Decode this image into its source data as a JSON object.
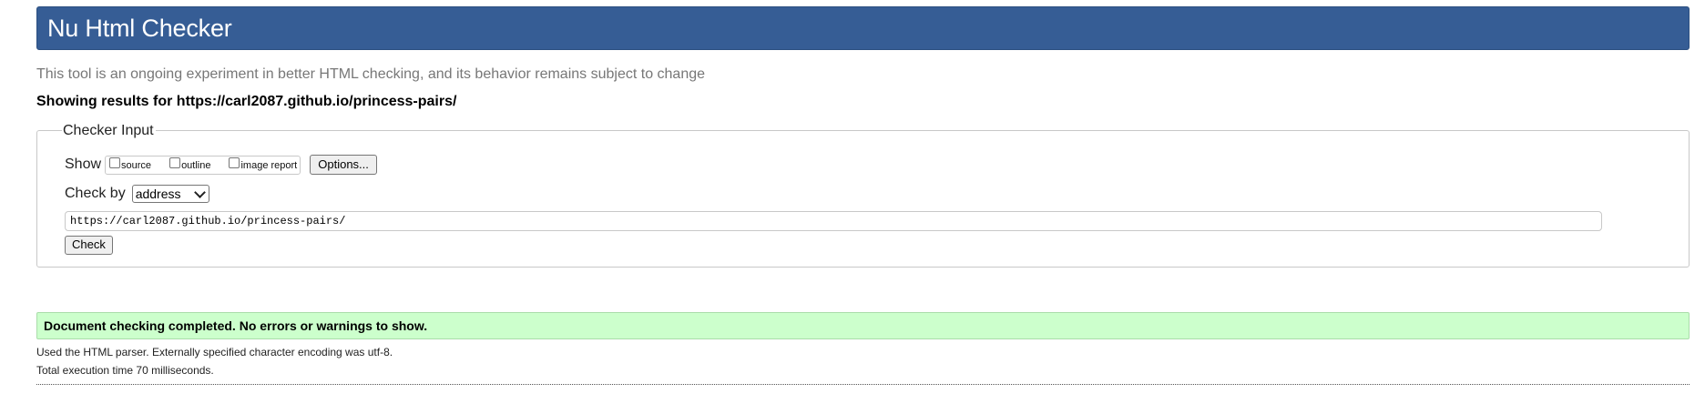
{
  "header": {
    "title": "Nu Html Checker"
  },
  "intro": "This tool is an ongoing experiment in better HTML checking, and its behavior remains subject to change",
  "showing_results": "Showing results for https://carl2087.github.io/princess-pairs/",
  "checker_input": {
    "legend": "Checker Input",
    "show_label": "Show",
    "show_options": [
      {
        "label": "source",
        "checked": false
      },
      {
        "label": "outline",
        "checked": false
      },
      {
        "label": "image report",
        "checked": false
      }
    ],
    "options_button": "Options...",
    "check_by_label": "Check by",
    "check_by_value": "address",
    "url_value": "https://carl2087.github.io/princess-pairs/",
    "check_button": "Check"
  },
  "result": {
    "message": "Document checking completed. No errors or warnings to show.",
    "parser_info": "Used the HTML parser. Externally specified character encoding was utf-8.",
    "execution_time": "Total execution time 70 milliseconds."
  },
  "colors": {
    "header_bg": "#365d95",
    "success_bg": "#ccffcc",
    "intro_text": "#777777"
  }
}
